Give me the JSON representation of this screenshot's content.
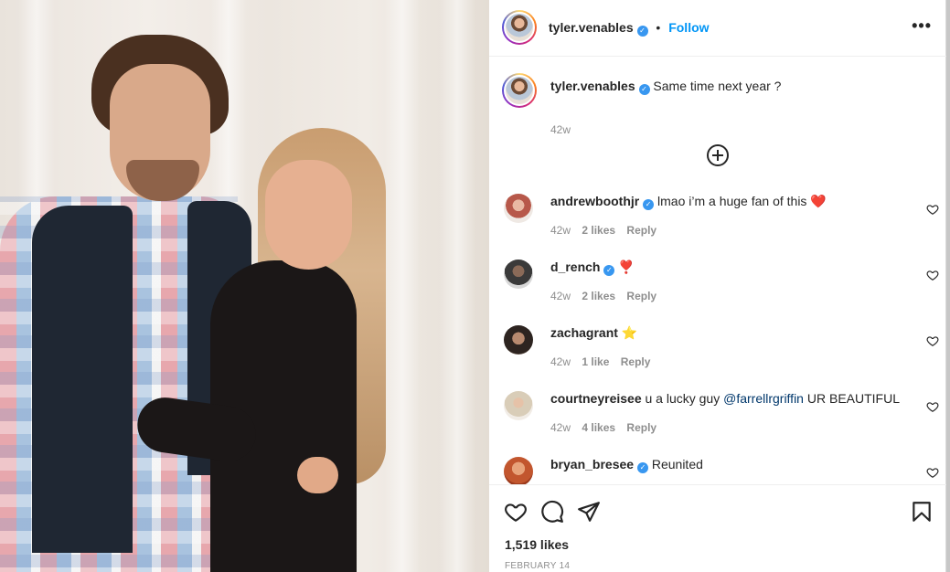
{
  "post": {
    "username": "tyler.venables",
    "verified_mark": "✓",
    "dot": "•",
    "follow_label": "Follow",
    "more_label": "•••",
    "caption": "Same time next year ?",
    "caption_time": "42w",
    "likes": "1,519 likes",
    "date": "FEBRUARY 14"
  },
  "comments": [
    {
      "username": "andrewboothjr",
      "verified": true,
      "text": "lmao i’m a huge fan of this ❤️",
      "time": "42w",
      "likes": "2 likes",
      "reply": "Reply",
      "avatar_color": "#b7584a"
    },
    {
      "username": "d_rench",
      "verified": true,
      "text": "❣️",
      "time": "42w",
      "likes": "2 likes",
      "reply": "Reply",
      "avatar_color": "#3a3a3a"
    },
    {
      "username": "zachagrant",
      "verified": false,
      "text": "⭐",
      "time": "42w",
      "likes": "1 like",
      "reply": "Reply",
      "avatar_color": "#2d2420"
    },
    {
      "username": "courtneyreisee",
      "verified": false,
      "text_before": "u a lucky guy ",
      "mention": "@farrellrgriffin",
      "text_after": " UR BEAUTIFUL",
      "time": "42w",
      "likes": "4 likes",
      "reply": "Reply",
      "avatar_color": "#d9cdb8"
    },
    {
      "username": "bryan_bresee",
      "verified": true,
      "text": "Reunited",
      "avatar_color": "#c2562e"
    }
  ],
  "icons": {
    "like": "heart-icon",
    "comment": "comment-icon",
    "share": "send-icon",
    "save": "bookmark-icon",
    "load_more": "plus-circle-icon",
    "options": "more-options-icon"
  },
  "colors": {
    "accent": "#0095f6",
    "verified": "#3897f0",
    "muted": "#8e8e8e",
    "text": "#262626"
  }
}
